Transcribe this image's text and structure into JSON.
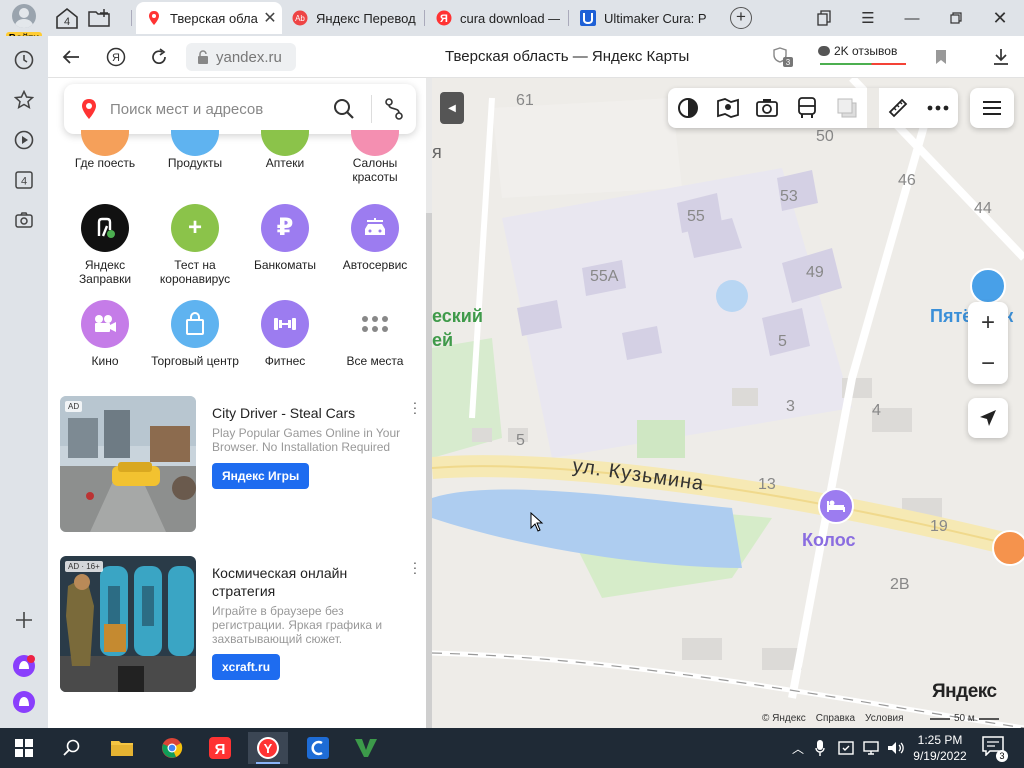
{
  "profile": {
    "login_label": "Войти"
  },
  "tabs_counter": "4",
  "tabs": [
    {
      "title": "Тверская обла",
      "active": true
    },
    {
      "title": "Яндекс Перевод"
    },
    {
      "title": "cura download —"
    },
    {
      "title": "Ultimaker Cura: Р"
    }
  ],
  "address": {
    "url": "yandex.ru",
    "page_title": "Тверская область — Яндекс Карты",
    "reviews_label": "2K отзывов",
    "extensions_badge": "3"
  },
  "sidebar": {
    "badge_count": "4"
  },
  "search": {
    "placeholder": "Поиск мест и адресов"
  },
  "categories_row1": [
    "Где поесть",
    "Продукты",
    "Аптеки",
    "Салоны красоты"
  ],
  "categories": [
    {
      "label": "Яндекс Заправки",
      "color": "#111111",
      "icon": "fuel-icon"
    },
    {
      "label": "Тест на коронавирус",
      "color": "#8bc34a",
      "icon": "plus-icon"
    },
    {
      "label": "Банкоматы",
      "color": "#9c7cf0",
      "icon": "ruble-icon"
    },
    {
      "label": "Автосервис",
      "color": "#9c7cf0",
      "icon": "car-icon"
    },
    {
      "label": "Кино",
      "color": "#c57ce8",
      "icon": "camera-icon"
    },
    {
      "label": "Торговый центр",
      "color": "#5fb3f0",
      "icon": "shopping-bag-icon"
    },
    {
      "label": "Фитнес",
      "color": "#9c7cf0",
      "icon": "dumbbell-icon"
    },
    {
      "label": "Все места",
      "color": "#ffffff",
      "icon": "grid-icon"
    }
  ],
  "ads": [
    {
      "badge": "AD",
      "title": "City Driver - Steal Cars",
      "desc": "Play Popular Games Online in Your Browser. No Installation Required",
      "button": "Яндекс Игры"
    },
    {
      "badge": "AD · 16+",
      "title": "Космическая онлайн стратегия",
      "desc": "Играйте в браузере без регистрации. Яркая графика и захватывающий сюжет.",
      "button": "xcraft.ru"
    }
  ],
  "map": {
    "street": "ул. Кузьмина",
    "numbers": [
      "61",
      "50",
      "46",
      "44",
      "53",
      "55",
      "55А",
      "49",
      "5",
      "3",
      "4",
      "5",
      "13",
      "19",
      "2В"
    ],
    "poi": {
      "pyaterochka": "Пятёрочк",
      "kolos": "Колос",
      "green_text_1": "еский",
      "green_text_2": "ей",
      "edge_text": "я"
    },
    "logo": "Яндекс",
    "copyright": "© Яндекс",
    "help": "Справка",
    "terms": "Условия",
    "scale": "50 м"
  },
  "taskbar": {
    "time": "1:25 PM",
    "date": "9/19/2022",
    "notifications": "3"
  }
}
